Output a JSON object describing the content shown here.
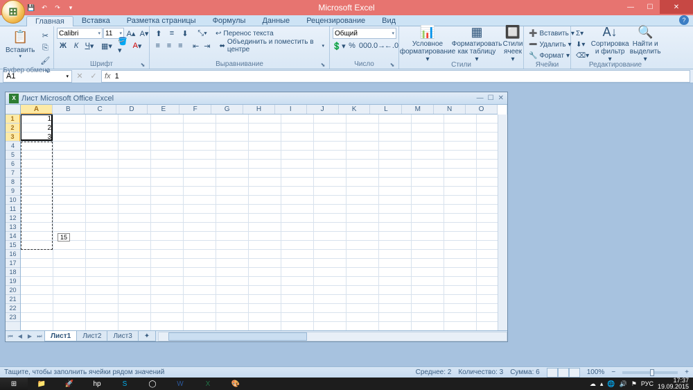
{
  "app_title": "Microsoft Excel",
  "qat": {
    "save": "💾",
    "undo": "↶",
    "redo": "↷"
  },
  "window_controls": {
    "min": "—",
    "max": "☐",
    "close": "✕"
  },
  "ribbon_tabs": [
    "Главная",
    "Вставка",
    "Разметка страницы",
    "Формулы",
    "Данные",
    "Рецензирование",
    "Вид"
  ],
  "ribbon": {
    "clipboard": {
      "label": "Буфер обмена",
      "paste": "Вставить"
    },
    "font": {
      "label": "Шрифт",
      "family": "Calibri",
      "size": "11"
    },
    "alignment": {
      "label": "Выравнивание",
      "wrap": "Перенос текста",
      "merge": "Объединить и поместить в центре"
    },
    "number": {
      "label": "Число",
      "format": "Общий"
    },
    "styles": {
      "label": "Стили",
      "cond": "Условное форматирование",
      "table": "Форматировать как таблицу",
      "cell": "Стили ячеек"
    },
    "cells": {
      "label": "Ячейки",
      "insert": "Вставить",
      "delete": "Удалить",
      "format": "Формат"
    },
    "editing": {
      "label": "Редактирование",
      "sort": "Сортировка и фильтр",
      "find": "Найти и выделить"
    }
  },
  "name_box": "A1",
  "formula_value": "1",
  "sheet_window_title": "Лист Microsoft Office Excel",
  "columns": [
    "A",
    "B",
    "C",
    "D",
    "E",
    "F",
    "G",
    "H",
    "I",
    "J",
    "K",
    "L",
    "M",
    "N",
    "O"
  ],
  "row_count": 23,
  "cell_data": {
    "A1": "1",
    "A2": "2",
    "A3": "3"
  },
  "selected_rows": [
    1,
    2,
    3
  ],
  "fill_tooltip": "15",
  "sheet_tabs": [
    "Лист1",
    "Лист2",
    "Лист3"
  ],
  "status_text": "Тащите, чтобы заполнить ячейки рядом значений",
  "status_agg": {
    "avg_label": "Среднее:",
    "avg": "2",
    "count_label": "Количество:",
    "count": "3",
    "sum_label": "Сумма:",
    "sum": "6"
  },
  "zoom": "100%",
  "tray": {
    "lang": "РУС",
    "time": "17:37",
    "date": "19.09.2015"
  }
}
